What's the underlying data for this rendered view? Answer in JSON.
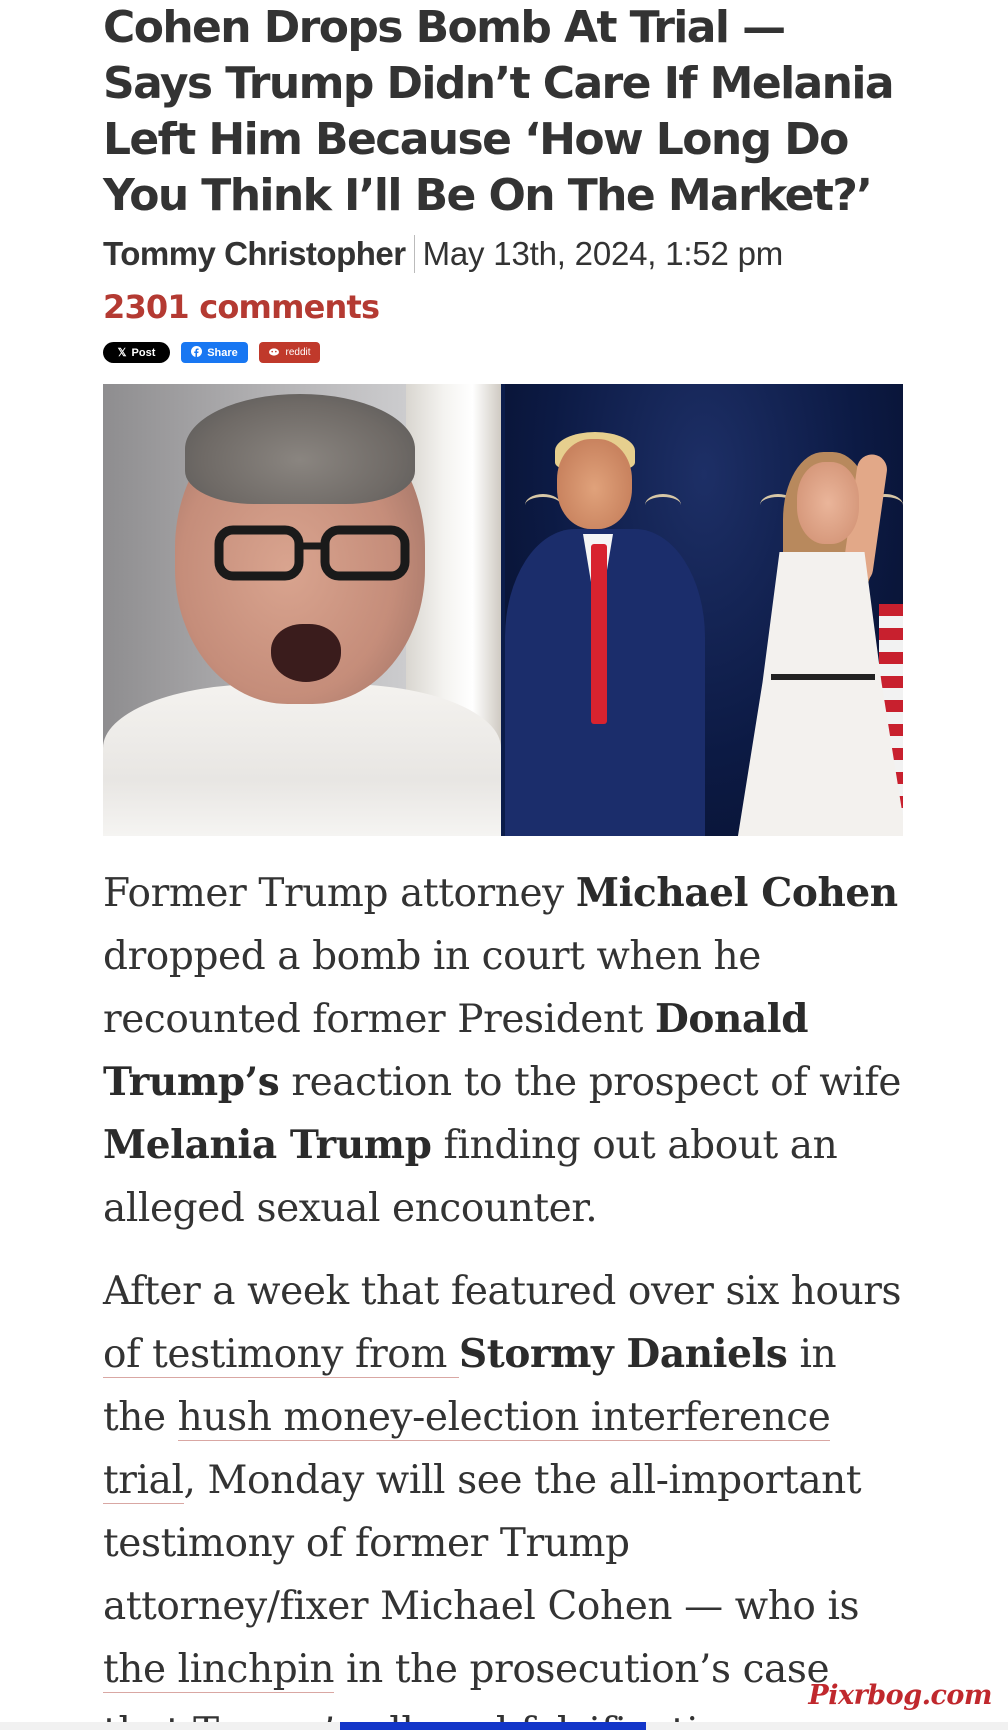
{
  "article": {
    "title": "Cohen Drops Bomb At Trial — Says Trump Didn’t Care If Melania Left Him Because ‘How Long Do You Think I’ll Be On The Market?’",
    "author": "Tommy Christopher",
    "date": "May 13th, 2024, 1:52 pm",
    "comments": "2301 comments"
  },
  "share": {
    "x_label": "Post",
    "facebook_label": "Share",
    "reddit_label": "reddit"
  },
  "body": {
    "p1": [
      {
        "t": "Former Trump attorney "
      },
      {
        "b": "Michael Cohen"
      },
      {
        "t": " dropped a bomb in court when he recounted former President "
      },
      {
        "b": "Donald Trump’s"
      },
      {
        "t": " reaction to the prospect of wife "
      },
      {
        "b": "Melania Trump"
      },
      {
        "t": " finding out about an alleged sexual encounter."
      }
    ],
    "p2": [
      {
        "t": "After a week that featured over six hours "
      },
      {
        "a": "of testimony from "
      },
      {
        "t": " "
      },
      {
        "b": "Stormy Daniels"
      },
      {
        "t": " in the "
      },
      {
        "a": "hush money-election interference trial"
      },
      {
        "t": ", Monday will see the all-important testimony of former Trump attorney/fixer Michael Cohen — who is "
      },
      {
        "a": "the linchpin"
      },
      {
        "t": " in the prosecution’s case that Trump’s "
      },
      {
        "a": "alleged falsification"
      }
    ]
  },
  "watermark": "Pixrbog.com",
  "colors": {
    "comments": "#b43a32",
    "facebook": "#1877f2",
    "reddit": "#c0392b",
    "x": "#000000"
  },
  "icons": {
    "x": "x-logo-icon",
    "facebook": "facebook-icon",
    "reddit": "reddit-icon"
  }
}
